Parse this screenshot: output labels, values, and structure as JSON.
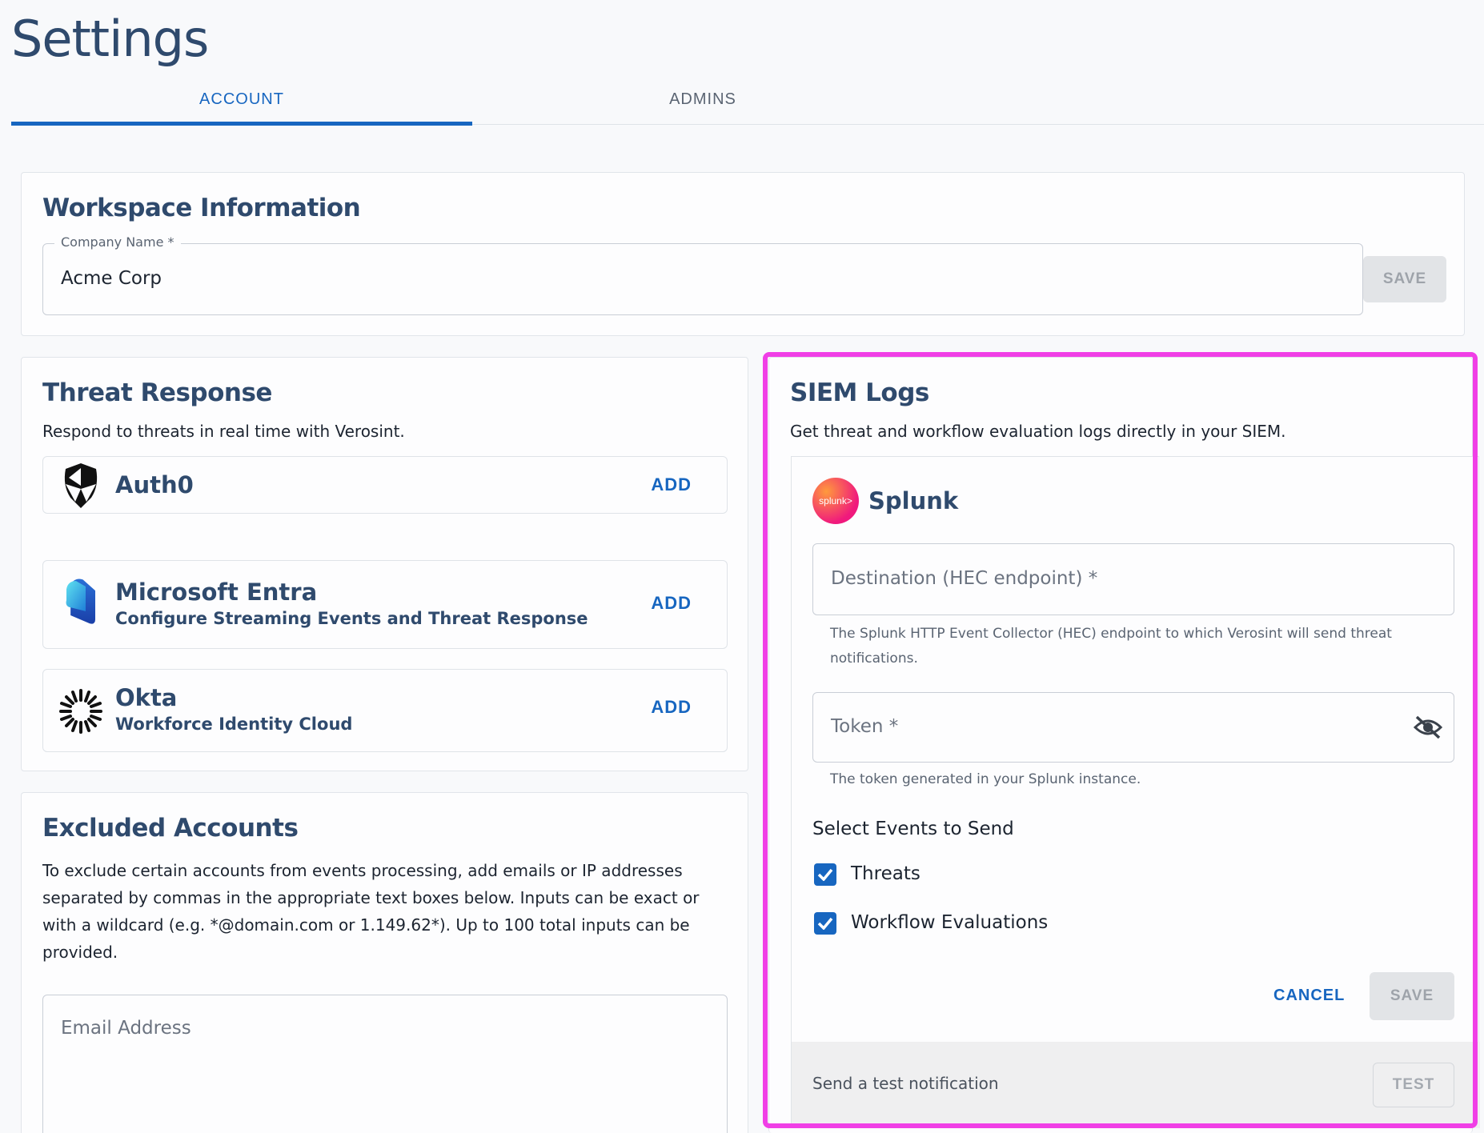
{
  "page": {
    "title": "Settings"
  },
  "tabs": [
    {
      "label": "ACCOUNT",
      "active": true
    },
    {
      "label": "ADMINS",
      "active": false
    }
  ],
  "workspace": {
    "title": "Workspace Information",
    "company_label": "Company Name *",
    "company_value": "Acme Corp",
    "save_label": "SAVE"
  },
  "threat_response": {
    "title": "Threat Response",
    "description": "Respond to threats in real time with Verosint.",
    "integrations": [
      {
        "name": "Auth0",
        "subtitle": "",
        "action": "ADD",
        "icon": "auth0-icon"
      },
      {
        "name": "Microsoft Entra",
        "subtitle": "Configure Streaming Events and Threat Response",
        "action": "ADD",
        "icon": "microsoft-entra-icon"
      },
      {
        "name": "Okta",
        "subtitle": "Workforce Identity Cloud",
        "action": "ADD",
        "icon": "okta-icon"
      }
    ]
  },
  "excluded_accounts": {
    "title": "Excluded Accounts",
    "description": "To exclude certain accounts from events processing, add emails or IP addresses separated by commas in the appropriate text boxes below. Inputs can be exact or with a wildcard (e.g. *@domain.com or 1.149.62*). Up to 100 total inputs can be provided.",
    "email_placeholder": "Email Address"
  },
  "siem": {
    "title": "SIEM Logs",
    "description": "Get threat and workflow evaluation logs directly in your SIEM.",
    "provider": {
      "name": "Splunk",
      "logo_text": "splunk>"
    },
    "destination_placeholder": "Destination (HEC endpoint) *",
    "destination_helper": "The Splunk HTTP Event Collector (HEC) endpoint to which Verosint will send threat notifications.",
    "token_placeholder": "Token *",
    "token_helper": "The token generated in your Splunk instance.",
    "events_heading": "Select Events to Send",
    "events": [
      {
        "label": "Threats",
        "checked": true
      },
      {
        "label": "Workflow Evaluations",
        "checked": true
      }
    ],
    "cancel_label": "CANCEL",
    "save_label": "SAVE",
    "test_text": "Send a test notification",
    "test_label": "TEST"
  },
  "colors": {
    "accent": "#1766c0",
    "heading": "#2f4a6d",
    "highlight": "#f03fe6",
    "disabled_bg": "#e2e4e7"
  }
}
